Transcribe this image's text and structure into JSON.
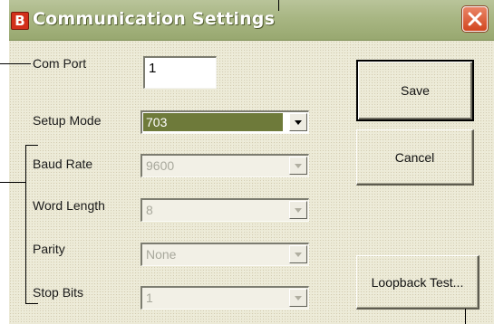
{
  "window": {
    "title": "Communication Settings",
    "app_icon_letter": "B",
    "colors": {
      "titlebar": "#a8b683",
      "dialog_background": "#ecead6",
      "close_button": "#d2461f",
      "selection": "#6e7a3a"
    }
  },
  "form": {
    "com_port": {
      "label": "Com Port",
      "value": "1"
    },
    "setup_mode": {
      "label": "Setup Mode",
      "value": "703"
    },
    "baud_rate": {
      "label": "Baud Rate",
      "value": "9600"
    },
    "word_length": {
      "label": "Word Length",
      "value": "8"
    },
    "parity": {
      "label": "Parity",
      "value": "None"
    },
    "stop_bits": {
      "label": "Stop Bits",
      "value": "1"
    }
  },
  "buttons": {
    "save": "Save",
    "cancel": "Cancel",
    "loopback": "Loopback Test..."
  },
  "icons": [
    "close-icon",
    "app-icon",
    "dropdown-arrow-icon"
  ]
}
